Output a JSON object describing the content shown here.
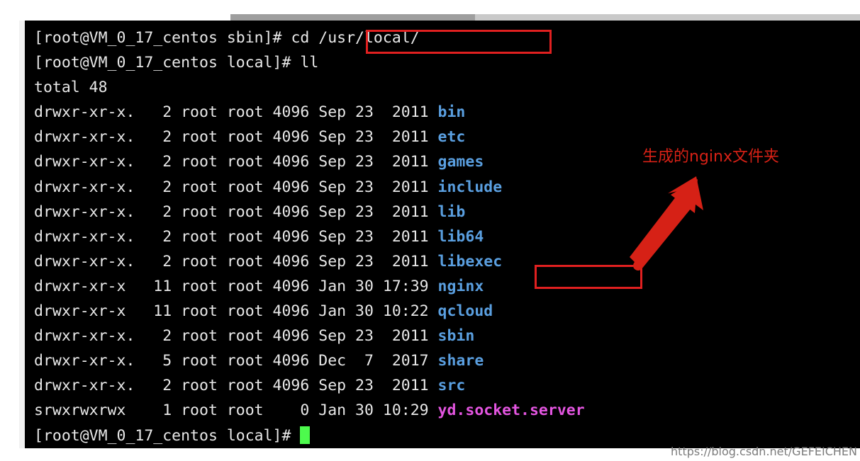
{
  "terminal": {
    "prompt_sbin": "[root@VM_0_17_centos sbin]# ",
    "command_cd": "cd /usr/local/",
    "prompt_local": "[root@VM_0_17_centos local]# ",
    "command_ll": "ll",
    "total_line": "total 48",
    "final_prompt": "[root@VM_0_17_centos local]# ",
    "cursor": "block-cursor",
    "listing": [
      {
        "perms": "drwxr-xr-x.",
        "links": "2",
        "owner": "root",
        "group": "root",
        "size": "4096",
        "month": "Sep",
        "day": "23",
        "time": "2011",
        "name": "bin",
        "kind": "dir"
      },
      {
        "perms": "drwxr-xr-x.",
        "links": "2",
        "owner": "root",
        "group": "root",
        "size": "4096",
        "month": "Sep",
        "day": "23",
        "time": "2011",
        "name": "etc",
        "kind": "dir"
      },
      {
        "perms": "drwxr-xr-x.",
        "links": "2",
        "owner": "root",
        "group": "root",
        "size": "4096",
        "month": "Sep",
        "day": "23",
        "time": "2011",
        "name": "games",
        "kind": "dir"
      },
      {
        "perms": "drwxr-xr-x.",
        "links": "2",
        "owner": "root",
        "group": "root",
        "size": "4096",
        "month": "Sep",
        "day": "23",
        "time": "2011",
        "name": "include",
        "kind": "dir"
      },
      {
        "perms": "drwxr-xr-x.",
        "links": "2",
        "owner": "root",
        "group": "root",
        "size": "4096",
        "month": "Sep",
        "day": "23",
        "time": "2011",
        "name": "lib",
        "kind": "dir"
      },
      {
        "perms": "drwxr-xr-x.",
        "links": "2",
        "owner": "root",
        "group": "root",
        "size": "4096",
        "month": "Sep",
        "day": "23",
        "time": "2011",
        "name": "lib64",
        "kind": "dir"
      },
      {
        "perms": "drwxr-xr-x.",
        "links": "2",
        "owner": "root",
        "group": "root",
        "size": "4096",
        "month": "Sep",
        "day": "23",
        "time": "2011",
        "name": "libexec",
        "kind": "dir"
      },
      {
        "perms": "drwxr-xr-x",
        "links": "11",
        "owner": "root",
        "group": "root",
        "size": "4096",
        "month": "Jan",
        "day": "30",
        "time": "17:39",
        "name": "nginx",
        "kind": "dir"
      },
      {
        "perms": "drwxr-xr-x",
        "links": "11",
        "owner": "root",
        "group": "root",
        "size": "4096",
        "month": "Jan",
        "day": "30",
        "time": "10:22",
        "name": "qcloud",
        "kind": "dir"
      },
      {
        "perms": "drwxr-xr-x.",
        "links": "2",
        "owner": "root",
        "group": "root",
        "size": "4096",
        "month": "Sep",
        "day": "23",
        "time": "2011",
        "name": "sbin",
        "kind": "dir"
      },
      {
        "perms": "drwxr-xr-x.",
        "links": "5",
        "owner": "root",
        "group": "root",
        "size": "4096",
        "month": "Dec",
        "day": "7",
        "time": "2017",
        "name": "share",
        "kind": "dir"
      },
      {
        "perms": "drwxr-xr-x.",
        "links": "2",
        "owner": "root",
        "group": "root",
        "size": "4096",
        "month": "Sep",
        "day": "23",
        "time": "2011",
        "name": "src",
        "kind": "dir"
      },
      {
        "perms": "srwxrwxrwx",
        "links": "1",
        "owner": "root",
        "group": "root",
        "size": "0",
        "month": "Jan",
        "day": "30",
        "time": "10:29",
        "name": "yd.socket.server",
        "kind": "socket"
      }
    ]
  },
  "annotations": {
    "nginx_note": "生成的nginx文件夹",
    "arrow": "up-right-arrow-icon",
    "highlight_command_label": "cd /usr/local/",
    "highlight_entry_label": "nginx",
    "red_color": "#e02020",
    "note_color": "#d62116"
  },
  "watermark": {
    "text": "https://blog.csdn.net/GEFEICHEN"
  },
  "colors": {
    "background": "#000000",
    "foreground": "#e8e8e8",
    "directory": "#5a9fe0",
    "socket": "#e355e0",
    "cursor": "#4dfa4d"
  }
}
